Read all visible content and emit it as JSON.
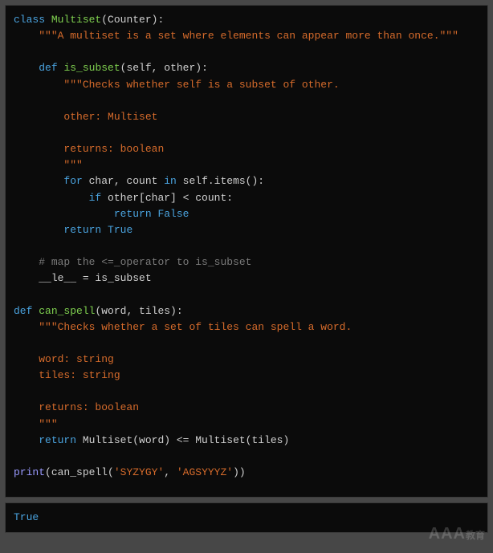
{
  "code": {
    "l1": {
      "kw": "class",
      "sp": " ",
      "cls": "Multiset",
      "paren": "(Counter):"
    },
    "l2": {
      "indent": "    ",
      "str": "\"\"\"A multiset is a set where elements can appear more than once.\"\"\""
    },
    "l3": {
      "indent": "    ",
      "kw": "def",
      "sp": " ",
      "cls": "is_subset",
      "paren": "(self, other):"
    },
    "l4": {
      "indent": "        ",
      "str": "\"\"\"Checks whether self is a subset of other."
    },
    "l5": {
      "indent": "        ",
      "str": "other: Multiset"
    },
    "l6": {
      "indent": "        ",
      "str": "returns: boolean"
    },
    "l7": {
      "indent": "        ",
      "str": "\"\"\""
    },
    "l8": {
      "indent": "        ",
      "kw": "for",
      "mid": " char, count ",
      "kw2": "in",
      "tail": " self.items():"
    },
    "l9": {
      "indent": "            ",
      "kw": "if",
      "tail": " other[char] < count:"
    },
    "l10": {
      "indent": "                ",
      "kw": "return",
      "sp": " ",
      "bool": "False"
    },
    "l11": {
      "indent": "        ",
      "kw": "return",
      "sp": " ",
      "bool": "True"
    },
    "l12": {
      "indent": "    ",
      "comm": "# map the <=_operator to is_subset"
    },
    "l13": {
      "indent": "    ",
      "name": "__le__ = is_subset"
    },
    "l14": {
      "kw": "def",
      "sp": " ",
      "cls": "can_spell",
      "paren": "(word, tiles):"
    },
    "l15": {
      "indent": "    ",
      "str": "\"\"\"Checks whether a set of tiles can spell a word."
    },
    "l16": {
      "indent": "    ",
      "str": "word: string"
    },
    "l17": {
      "indent": "    ",
      "str": "tiles: string"
    },
    "l18": {
      "indent": "    ",
      "str": "returns: boolean"
    },
    "l19": {
      "indent": "    ",
      "str": "\"\"\""
    },
    "l20": {
      "indent": "    ",
      "kw": "return",
      "tail": " Multiset(word) <= Multiset(tiles)"
    },
    "l21": {
      "call": "print",
      "paren": "(can_spell(",
      "arg1": "'SYZYGY'",
      "comma": ", ",
      "arg2": "'AGSYYYZ'",
      "close": "))"
    }
  },
  "output": {
    "value": "True"
  },
  "watermark": {
    "main": "AAA",
    "sub": "教育"
  }
}
